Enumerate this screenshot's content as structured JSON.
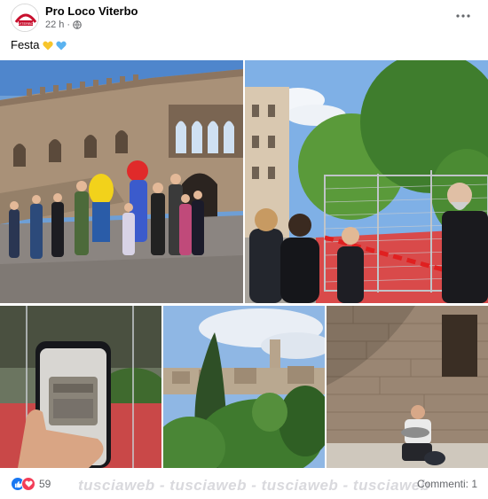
{
  "post": {
    "page_name": "Pro Loco Viterbo",
    "timestamp": "22 h",
    "separator": "·",
    "privacy_icon": "globe-icon",
    "text": "Festa",
    "emoji": [
      "yellow-heart",
      "blue-heart"
    ]
  },
  "reactions": {
    "types": [
      "like",
      "love"
    ],
    "count": "59",
    "comments_label": "Commenti: 1"
  },
  "watermark": "tusciaweb - tusciaweb - tusciaweb - tusciaweb",
  "colors": {
    "like_blue": "#1877f2",
    "love_red": "#f33e58",
    "yellow_heart": "#f7c52b",
    "blue_heart": "#5bb3f0",
    "meta_gray": "#65676b"
  }
}
